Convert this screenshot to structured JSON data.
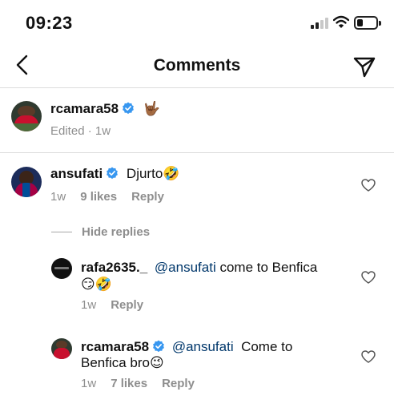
{
  "status_bar": {
    "time": "09:23"
  },
  "header": {
    "title": "Comments"
  },
  "caption": {
    "username": "rcamara58",
    "text": "🤟🏾",
    "edited": "Edited",
    "time": "1w"
  },
  "comments": [
    {
      "username": "ansufati",
      "text": "Djurto",
      "emoji": "🤣",
      "time": "1w",
      "likes": "9 likes",
      "reply": "Reply"
    }
  ],
  "hide_replies": "Hide replies",
  "replies": [
    {
      "username": "rafa2635._",
      "mention": "@ansufati",
      "text": " come to Benfica",
      "line2_emoji": "😏🤣",
      "time": "1w",
      "reply": "Reply"
    },
    {
      "username": "rcamara58",
      "mention": "@ansufati",
      "text": "  Come to",
      "line2_text": "Benfica bro",
      "line2_emoji": "😉",
      "time": "1w",
      "likes": "7 likes",
      "reply": "Reply"
    }
  ],
  "colors": {
    "verified": "#3897f0",
    "mention": "#00376b",
    "muted": "#8e8e8e"
  },
  "icons": [
    "back-icon",
    "send-icon",
    "verified-icon",
    "heart-icon"
  ]
}
